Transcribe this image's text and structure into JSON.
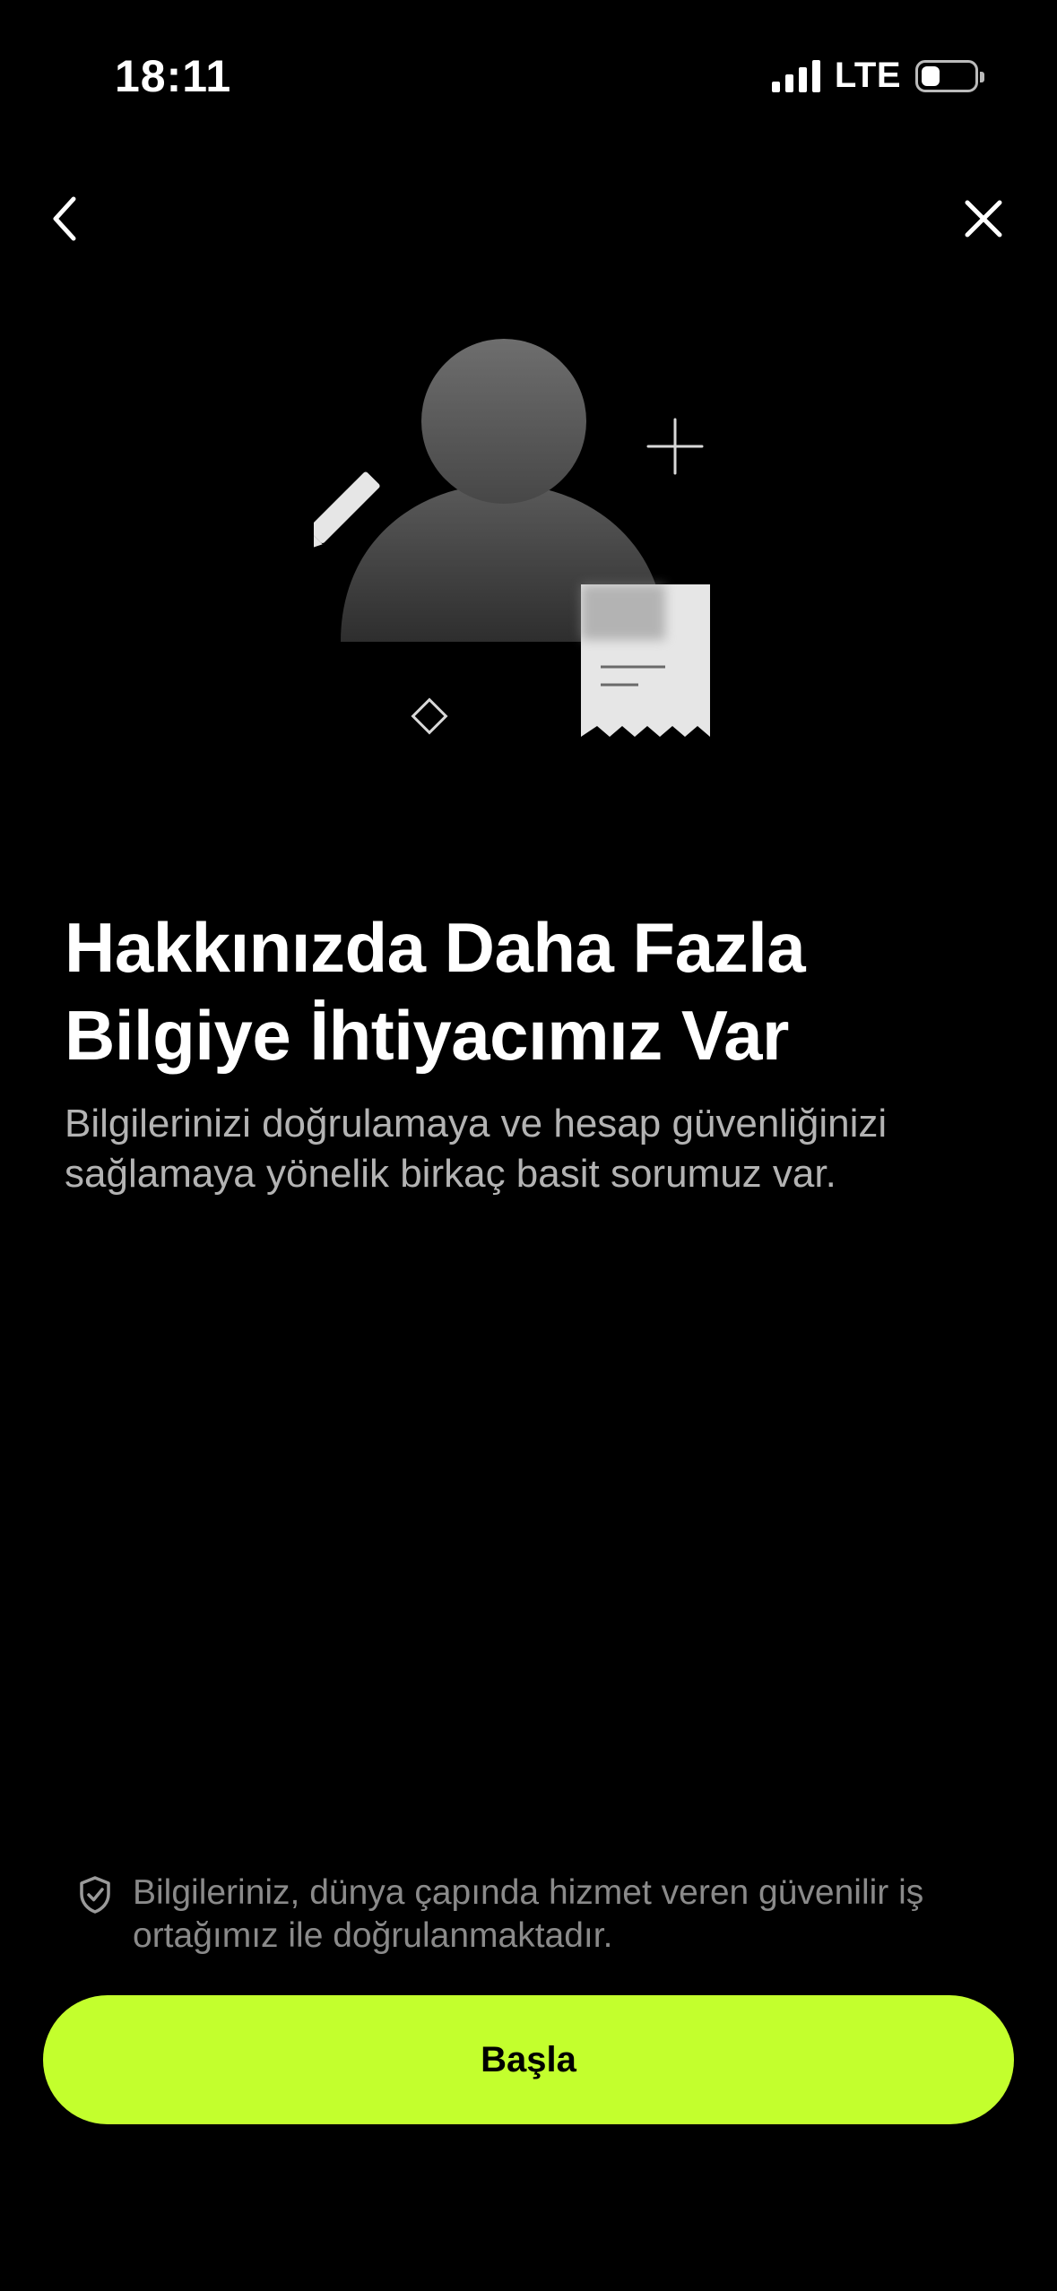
{
  "status_bar": {
    "time": "18:11",
    "network": "LTE"
  },
  "nav": {
    "back_icon": "chevron-left-icon",
    "close_icon": "close-icon"
  },
  "content": {
    "headline": "Hakkınızda Daha Fazla Bilgiye İhtiyacımız Var",
    "subtitle": "Bilgilerinizi doğrulamaya ve hesap güvenliğinizi sağlamaya yönelik birkaç basit sorumuz var."
  },
  "footer": {
    "note_icon": "shield-check-icon",
    "note": "Bilgileriniz, dünya çapında hizmet veren güvenilir iş ortağımız ile doğrulanmaktadır.",
    "cta_label": "Başla"
  },
  "colors": {
    "background": "#000000",
    "accent": "#c3ff2d",
    "subtitle": "#b3b3b3",
    "note": "#8a8a8a"
  }
}
